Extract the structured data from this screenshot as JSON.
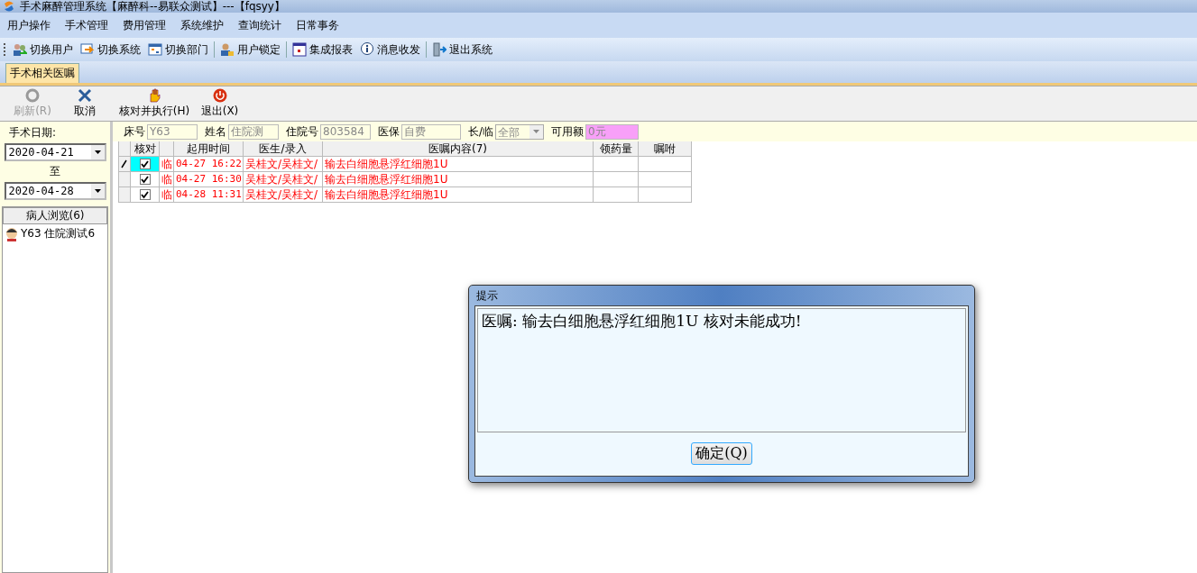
{
  "window": {
    "title": "手术麻醉管理系统【麻醉科--易联众测试】---【fqsyy】"
  },
  "menu": [
    "用户操作",
    "手术管理",
    "费用管理",
    "系统维护",
    "查询统计",
    "日常事务"
  ],
  "toolbar": [
    {
      "label": "切换用户"
    },
    {
      "label": "切换系统"
    },
    {
      "label": "切换部门"
    },
    {
      "label": "用户锁定"
    },
    {
      "label": "集成报表"
    },
    {
      "label": "消息收发"
    },
    {
      "label": "退出系统"
    }
  ],
  "tabs": [
    {
      "label": "手术相关医嘱",
      "selected": true
    }
  ],
  "actions": [
    {
      "label": "刷新(R)",
      "disabled": true
    },
    {
      "label": "取消",
      "disabled": false
    },
    {
      "label": "核对并执行(H)",
      "disabled": false
    },
    {
      "label": "退出(X)",
      "disabled": false
    }
  ],
  "sidebar": {
    "date_label": "手术日期:",
    "date_from": "2020-04-21",
    "to_label": "至",
    "date_to": "2020-04-28",
    "patients_header": "病人浏览(6)",
    "patients": [
      {
        "label": "Y63 住院测试6",
        "selected": false
      }
    ]
  },
  "filters": [
    {
      "label": "床号",
      "value": "Y63",
      "kind": "text"
    },
    {
      "label": "姓名",
      "value": "住院测",
      "kind": "text"
    },
    {
      "label": "住院号",
      "value": "803584",
      "kind": "text"
    },
    {
      "label": "医保",
      "value": "自费",
      "kind": "text"
    },
    {
      "label": "长/临",
      "value": "全部",
      "kind": "select"
    },
    {
      "label": "可用额",
      "value": "0元",
      "kind": "amount"
    }
  ],
  "table": {
    "columns": [
      "核对",
      "起用时间",
      "医生/录入",
      "医嘱内容(7)",
      "领药量",
      "嘱咐"
    ],
    "rows": [
      {
        "selected": true,
        "checked": true,
        "type": "临",
        "time": "04-27 16:22",
        "doctor": "吴桂文/吴桂文/",
        "content": "输去白细胞悬浮红细胞1U"
      },
      {
        "selected": false,
        "checked": true,
        "type": "临",
        "time": "04-27 16:30",
        "doctor": "吴桂文/吴桂文/",
        "content": "输去白细胞悬浮红细胞1U"
      },
      {
        "selected": false,
        "checked": true,
        "type": "临",
        "time": "04-28 11:31",
        "doctor": "吴桂文/吴桂文/",
        "content": "输去白细胞悬浮红细胞1U"
      }
    ]
  },
  "dialog": {
    "title": "提示",
    "message": "医嘱: 输去白细胞悬浮红细胞1U 核对未能成功!",
    "button": "确定(Q)"
  }
}
